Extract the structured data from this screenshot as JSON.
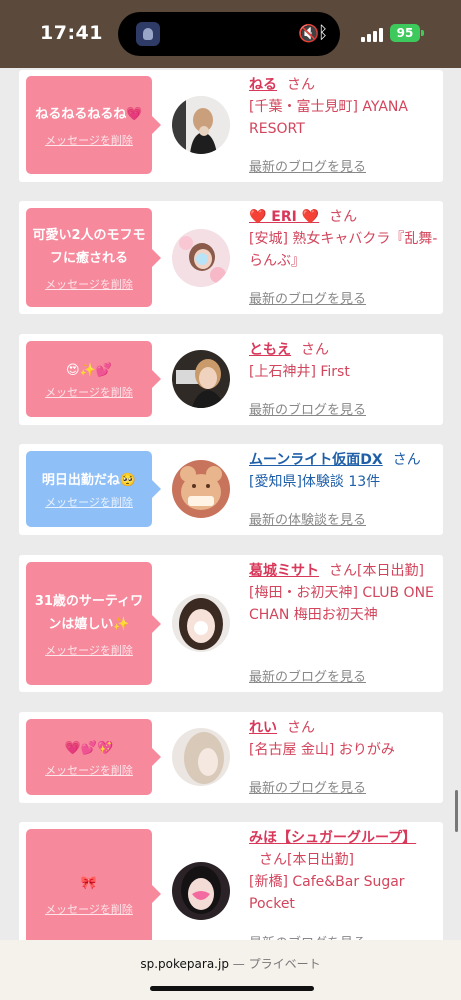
{
  "status_bar": {
    "time": "17:41",
    "battery": "95"
  },
  "cards": [
    {
      "message": "ねるねるねるね💗",
      "delete_label": "メッセージを削除",
      "name": "ねる",
      "honorific": "さん",
      "detail": "[千葉・富士見町] AYANA RESORT",
      "link": "最新のブログを見る"
    },
    {
      "message": "可愛い2人のモフモフに癒される",
      "delete_label": "メッセージを削除",
      "name": "❤️ ERI ❤️",
      "honorific": "さん",
      "detail": "[安城] 熟女キャバクラ『乱舞-らんぶ』",
      "link": "最新のブログを見る"
    },
    {
      "message": "😍✨💕",
      "delete_label": "メッセージを削除",
      "name": "ともえ",
      "honorific": "さん",
      "detail": "[上石神井] First",
      "link": "最新のブログを見る"
    },
    {
      "message": "明日出勤だね🥺",
      "delete_label": "メッセージを削除",
      "name": "ムーンライト仮面DX",
      "honorific": "さん",
      "detail": "[愛知県]体験談 13件",
      "link": "最新の体験談を見る"
    },
    {
      "message": "31歳のサーティワンは嬉しい✨",
      "delete_label": "メッセージを削除",
      "name": "葛城ミサト",
      "honorific": "さん[本日出勤]",
      "detail": "[梅田・お初天神] CLUB ONE CHAN 梅田お初天神",
      "link": "最新のブログを見る"
    },
    {
      "message": "💗💕💖",
      "delete_label": "メッセージを削除",
      "name": "れい",
      "honorific": "さん",
      "detail": "[名古屋 金山] おりがみ",
      "link": "最新のブログを見る"
    },
    {
      "message": "🎀",
      "delete_label": "メッセージを削除",
      "name": "みほ【シュガーグループ】",
      "honorific": "さん[本日出勤]",
      "detail": "[新橋] Cafe&Bar Sugar Pocket",
      "link": "最新のブログを見る"
    }
  ],
  "browser": {
    "domain": "sp.pokepara.jp",
    "mode": "— プライベート"
  }
}
